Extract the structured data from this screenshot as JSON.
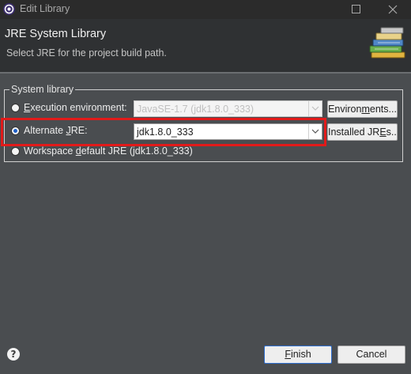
{
  "window": {
    "title": "Edit Library",
    "app_icon": "eclipse-gear-icon",
    "maximize_icon": "maximize-icon",
    "close_icon": "close-icon"
  },
  "banner": {
    "title": "JRE System Library",
    "subtitle": "Select JRE for the project build path.",
    "icon": "library-books-icon"
  },
  "group": {
    "legend": "System library",
    "execution_environment": {
      "label_prefix": "E",
      "label_rest": "xecution environment:",
      "selected": false,
      "value": "JavaSE-1.7 (jdk1.8.0_333)",
      "enabled": false,
      "button_prefix": "Environ",
      "button_underlined": "m",
      "button_suffix": "ents..."
    },
    "alternate_jre": {
      "label_prefix": "Alternate ",
      "label_underlined": "J",
      "label_suffix": "RE:",
      "selected": true,
      "value": "jdk1.8.0_333",
      "enabled": true,
      "button_prefix": "Installed JR",
      "button_underlined": "E",
      "button_suffix": "s..."
    },
    "workspace_default": {
      "label_prefix": "Workspace ",
      "label_underlined": "d",
      "label_suffix": "efault JRE (jdk1.8.0_333)",
      "selected": false
    }
  },
  "footer": {
    "help_icon": "help-icon",
    "help_glyph": "?",
    "finish_underlined": "F",
    "finish_rest": "inish",
    "cancel_label": "Cancel"
  },
  "colors": {
    "background": "#4a4d50",
    "banner": "#2f3133",
    "highlight": "#e21a1a",
    "focus_border": "#2f6fd0"
  }
}
